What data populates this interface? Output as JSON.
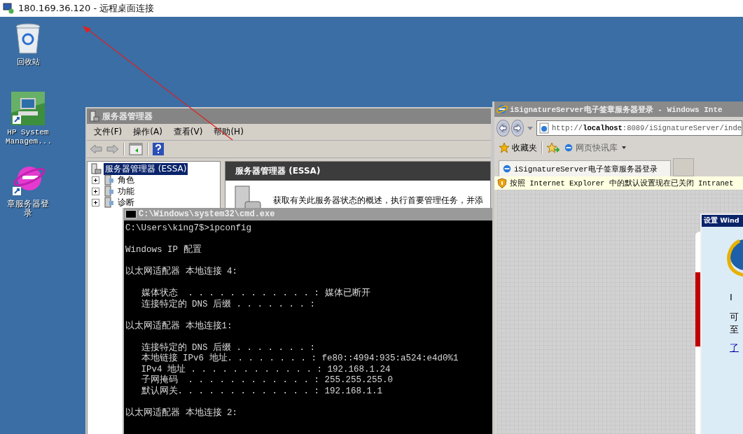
{
  "window": {
    "title": "180.169.36.120 - 远程桌面连接"
  },
  "desktop_icons": [
    {
      "label": "回收站",
      "kind": "recycle"
    },
    {
      "label": "HP System Managem...",
      "kind": "computer"
    },
    {
      "label": "章服务器登录",
      "kind": "ie"
    }
  ],
  "server_manager": {
    "title": "服务器管理器",
    "menu": [
      "文件(F)",
      "操作(A)",
      "查看(V)",
      "帮助(H)"
    ],
    "tree": [
      {
        "label": "服务器管理器 (ESSA)",
        "selected": true,
        "children": [
          {
            "label": "角色",
            "selected": false,
            "expanded": false
          },
          {
            "label": "功能",
            "selected": false,
            "expanded": false
          },
          {
            "label": "诊断",
            "selected": false,
            "expanded": false
          }
        ]
      }
    ],
    "header": "服务器管理器 (ESSA)",
    "summary": "获取有关此服务器状态的概述，执行首要管理任务，并添"
  },
  "cmd": {
    "title": "C:\\Windows\\system32\\cmd.exe",
    "lines": [
      {
        "kind": "command",
        "text": "C:\\Users\\king7$>ipconfig"
      },
      {
        "kind": "title",
        "text": "Windows IP 配置"
      },
      {
        "kind": "adapter",
        "text": "以太网适配器 本地连接 4:"
      },
      {
        "kind": "entry",
        "text": "   媒体状态  . . . . . . . . . . . . : 媒体已断开"
      },
      {
        "kind": "entry",
        "text": "   连接特定的 DNS 后缀 . . . . . . . :"
      },
      {
        "kind": "adapter",
        "text": "以太网适配器 本地连接1:"
      },
      {
        "kind": "entry",
        "text": "   连接特定的 DNS 后缀 . . . . . . . :"
      },
      {
        "kind": "entry",
        "text": "   本地链接 IPv6 地址. . . . . . . . : fe80::4994:935:a524:e4d0%1"
      },
      {
        "kind": "entry",
        "text": "   IPv4 地址 . . . . . . . . . . . . : 192.168.1.24"
      },
      {
        "kind": "entry",
        "text": "   子网掩码  . . . . . . . . . . . . : 255.255.255.0"
      },
      {
        "kind": "entry",
        "text": "   默认网关. . . . . . . . . . . . . : 192.168.1.1"
      },
      {
        "kind": "adapter",
        "text": "以太网适配器 本地连接 2:"
      }
    ]
  },
  "browser": {
    "title": "iSignatureServer电子签章服务器登录 - Windows Inte",
    "address": "http://**localhost**:8089/iSignatureServer/inde",
    "favorites_label": "收藏夹",
    "feed_label": "网页快讯库",
    "tabs": [
      {
        "label": "iSignatureServer电子签章服务器登录",
        "selected": true
      }
    ],
    "info_bar": "按照 Internet Explorer 中的默认设置现在已关闭 Intranet",
    "dialog": {
      "title": "设置 Wind",
      "fragments": [
        "I",
        "可",
        "至"
      ],
      "link": "了"
    }
  }
}
